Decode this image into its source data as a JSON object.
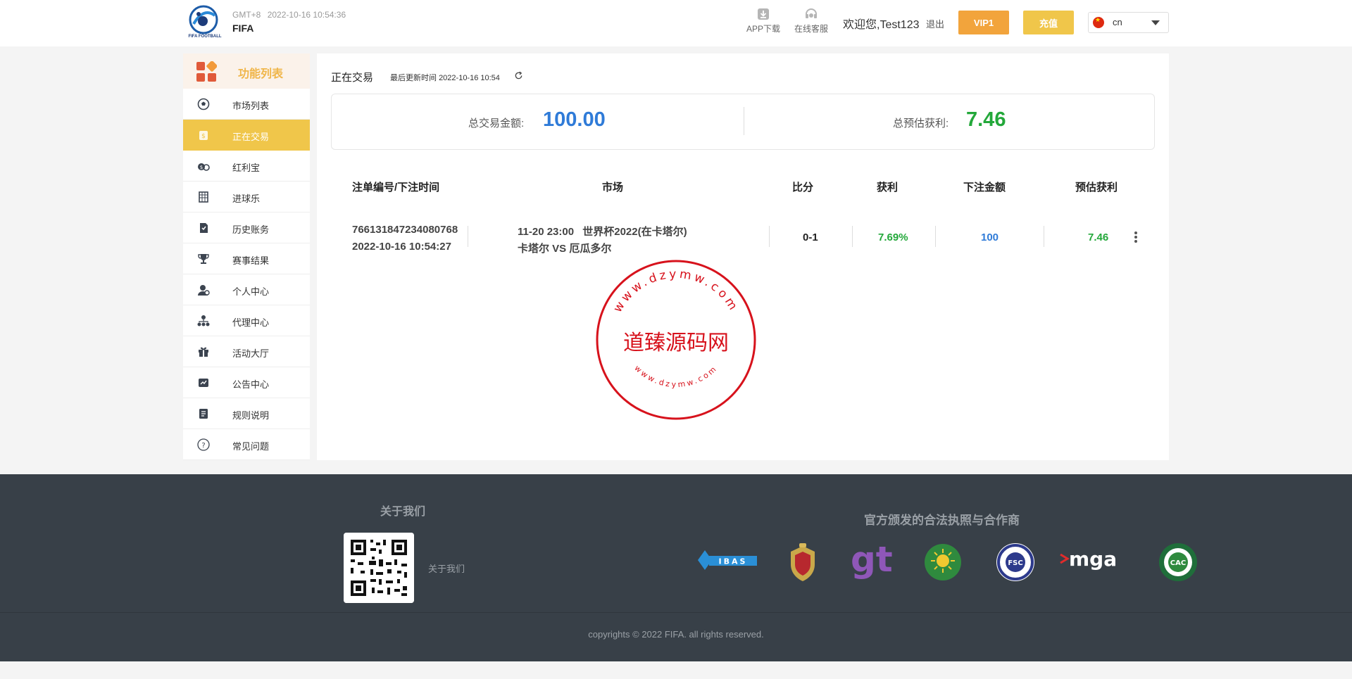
{
  "header": {
    "logo_text": "FIFA FOOTBALL",
    "gmt": "GMT+8",
    "datetime": "2022-10-16 10:54:36",
    "brand": "FIFA",
    "app_download": "APP下载",
    "online_service": "在线客服",
    "welcome": "欢迎您,Test123",
    "logout": "退出",
    "vip": "VIP1",
    "recharge": "充值",
    "language": "cn"
  },
  "sidebar": {
    "title": "功能列表",
    "items": [
      {
        "label": "市场列表",
        "icon": "soccer-ball-icon"
      },
      {
        "label": "正在交易",
        "icon": "trading-icon",
        "active": true
      },
      {
        "label": "红利宝",
        "icon": "bonus-icon"
      },
      {
        "label": "进球乐",
        "icon": "goal-icon"
      },
      {
        "label": "历史账务",
        "icon": "history-icon"
      },
      {
        "label": "赛事结果",
        "icon": "trophy-icon"
      },
      {
        "label": "个人中心",
        "icon": "user-icon"
      },
      {
        "label": "代理中心",
        "icon": "agent-icon"
      },
      {
        "label": "活动大厅",
        "icon": "gift-icon"
      },
      {
        "label": "公告中心",
        "icon": "announcement-icon"
      },
      {
        "label": "规则说明",
        "icon": "rules-icon"
      },
      {
        "label": "常见问题",
        "icon": "faq-icon"
      }
    ]
  },
  "main": {
    "title": "正在交易",
    "last_update_label": "最后更新时间",
    "last_update": "2022-10-16 10:54",
    "summary": {
      "total_amount_label": "总交易金额:",
      "total_amount": "100.00",
      "total_profit_label": "总预估获利:",
      "total_profit": "7.46"
    },
    "table": {
      "headers": [
        "注单编号/下注时间",
        "市场",
        "比分",
        "获利",
        "下注金额",
        "预估获利"
      ],
      "rows": [
        {
          "order_id": "766131847234080768",
          "bet_time": "2022-10-16 10:54:27",
          "market_time": "11-20 23:00",
          "market_league": "世界杯2022(在卡塔尔)",
          "market_teams": "卡塔尔 VS 厄瓜多尔",
          "score": "0-1",
          "profit_rate": "7.69%",
          "amount": "100",
          "est_profit": "7.46"
        }
      ]
    }
  },
  "stamp": {
    "top_text": "www.dzymw.com",
    "center_text": "道臻源码网",
    "bottom_text": "www.dzymw.com"
  },
  "footer": {
    "about_title": "关于我们",
    "about_link": "关于我们",
    "license_title": "官方颁发的合法执照与合作商",
    "license_logos": {
      "ibas": "IBAS",
      "gt": "gt",
      "fsc": "FSC",
      "mga": "mga",
      "cac": "CAC"
    },
    "copyright": "copyrights © 2022 FIFA. all rights reserved."
  },
  "colors": {
    "accent_yellow": "#f0c64a",
    "vip_orange": "#f2a43c",
    "amount_blue": "#2f7bd8",
    "profit_green": "#23a83a",
    "stamp_red": "#d7121c",
    "footer_bg": "#384048"
  }
}
